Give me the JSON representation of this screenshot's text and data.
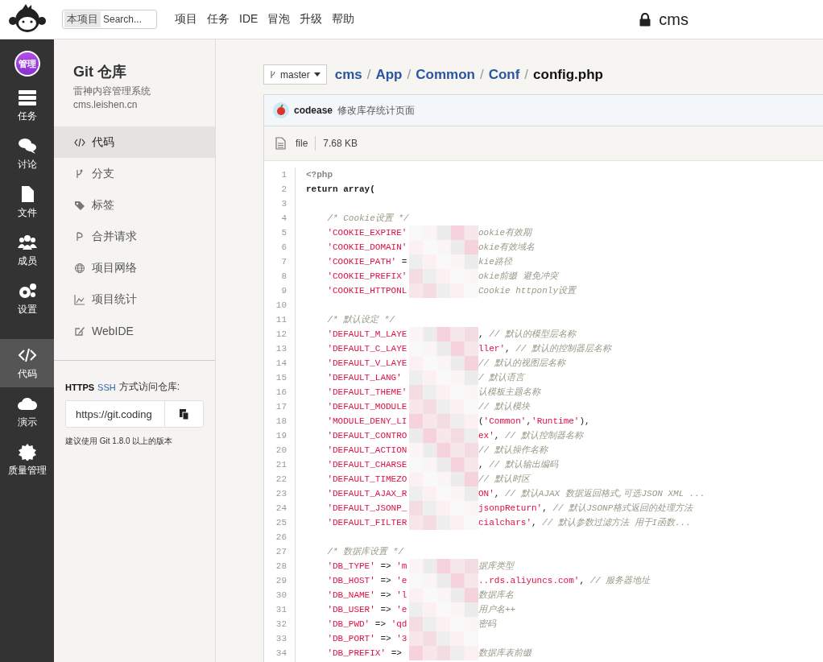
{
  "topbar": {
    "search_scope": "本项目",
    "search_placeholder": "Search...",
    "nav": [
      "项目",
      "任务",
      "IDE",
      "冒泡",
      "升级",
      "帮助"
    ],
    "project": "cms"
  },
  "rail": {
    "avatar": "管理",
    "items": [
      {
        "label": "任务",
        "kind": "tasks",
        "selected": false
      },
      {
        "label": "讨论",
        "kind": "chat",
        "selected": false
      },
      {
        "label": "文件",
        "kind": "file",
        "selected": false
      },
      {
        "label": "成员",
        "kind": "users",
        "selected": false
      },
      {
        "label": "设置",
        "kind": "gears",
        "selected": false
      }
    ],
    "bottom_items": [
      {
        "label": "代码",
        "kind": "code",
        "selected": true
      },
      {
        "label": "演示",
        "kind": "cloud",
        "selected": false
      },
      {
        "label": "质量管理",
        "kind": "badge",
        "selected": false
      }
    ]
  },
  "repo": {
    "title": "Git 仓库",
    "subtitle": "雷神内容管理系统",
    "domain": "cms.leishen.cn",
    "nav": [
      {
        "label": "代码",
        "kind": "code",
        "selected": true
      },
      {
        "label": "分支",
        "kind": "branch",
        "selected": false
      },
      {
        "label": "标签",
        "kind": "tag",
        "selected": false
      },
      {
        "label": "合并请求",
        "kind": "merge",
        "selected": false
      },
      {
        "label": "项目网络",
        "kind": "globe",
        "selected": false
      },
      {
        "label": "项目统计",
        "kind": "chart",
        "selected": false
      },
      {
        "label": "WebIDE",
        "kind": "edit",
        "selected": false
      }
    ],
    "clone": {
      "protocols": [
        {
          "label": "HTTPS",
          "selected": true
        },
        {
          "label": "SSH",
          "selected": false
        }
      ],
      "label": "方式访问仓库:",
      "url": "https://git.coding",
      "note": "建议使用 Git 1.8.0 以上的版本"
    }
  },
  "file_view": {
    "branch": "master",
    "path": [
      "cms",
      "App",
      "Common",
      "Conf"
    ],
    "separator": "/",
    "file": "config.php",
    "commit": {
      "author": "codease",
      "message": "修改库存统计页面"
    },
    "info": {
      "type": "file",
      "size": "7.68 KB"
    },
    "lines": [
      {
        "n": "1",
        "pre": [
          {
            "kind": "meta",
            "text": "<?php"
          }
        ]
      },
      {
        "n": "2",
        "pre": [
          {
            "kind": "keyword",
            "text": "return array("
          }
        ]
      },
      {
        "n": "3"
      },
      {
        "n": "4",
        "pre": [
          {
            "kind": "comment",
            "text": "    /* Cookie设置 */"
          }
        ]
      },
      {
        "n": "5",
        "redacted": true,
        "pre": [
          {
            "kind": "key",
            "text": "    'COOKIE_EXPIRE'"
          }
        ],
        "post": [
          {
            "kind": "comment",
            "text": "ookie有效期"
          }
        ]
      },
      {
        "n": "6",
        "redacted": true,
        "pre": [
          {
            "kind": "key",
            "text": "    'COOKIE_DOMAIN'"
          }
        ],
        "post": [
          {
            "kind": "comment",
            "text": "okie有效域名"
          }
        ]
      },
      {
        "n": "7",
        "redacted": true,
        "pre": [
          {
            "kind": "key",
            "text": "    'COOKIE_PATH'"
          },
          {
            "kind": "operator",
            "text": " ="
          }
        ],
        "post": [
          {
            "kind": "comment",
            "text": "kie路径"
          }
        ]
      },
      {
        "n": "8",
        "redacted": true,
        "pre": [
          {
            "kind": "key",
            "text": "    'COOKIE_PREFIX'"
          }
        ],
        "post": [
          {
            "kind": "comment",
            "text": "okie前缀 避免冲突"
          }
        ]
      },
      {
        "n": "9",
        "redacted": true,
        "pre": [
          {
            "kind": "key",
            "text": "    'COOKIE_HTTPONL"
          }
        ],
        "post": [
          {
            "kind": "comment",
            "text": "Cookie httponly设置"
          }
        ]
      },
      {
        "n": "10"
      },
      {
        "n": "11",
        "pre": [
          {
            "kind": "comment",
            "text": "    /* 默认设定 */"
          }
        ]
      },
      {
        "n": "12",
        "redacted": true,
        "pre": [
          {
            "kind": "key",
            "text": "    'DEFAULT_M_LAYE"
          }
        ],
        "post": [
          {
            "kind": "operator",
            "text": ", "
          },
          {
            "kind": "comment",
            "text": "// 默认的模型层名称"
          }
        ]
      },
      {
        "n": "13",
        "redacted": true,
        "pre": [
          {
            "kind": "key",
            "text": "    'DEFAULT_C_LAYE"
          }
        ],
        "post": [
          {
            "kind": "string",
            "text": "ller'"
          },
          {
            "kind": "operator",
            "text": ", "
          },
          {
            "kind": "comment",
            "text": "// 默认的控制器层名称"
          }
        ]
      },
      {
        "n": "14",
        "redacted": true,
        "pre": [
          {
            "kind": "key",
            "text": "    'DEFAULT_V_LAYE"
          }
        ],
        "post": [
          {
            "kind": "comment",
            "text": "// 默认的视图层名称"
          }
        ]
      },
      {
        "n": "15",
        "redacted": true,
        "pre": [
          {
            "kind": "key",
            "text": "    'DEFAULT_LANG'"
          }
        ],
        "post": [
          {
            "kind": "comment",
            "text": "/ 默认语言"
          }
        ]
      },
      {
        "n": "16",
        "redacted": true,
        "pre": [
          {
            "kind": "key",
            "text": "    'DEFAULT_THEME'"
          }
        ],
        "post": [
          {
            "kind": "comment",
            "text": "认模板主题名称"
          }
        ]
      },
      {
        "n": "17",
        "redacted": true,
        "pre": [
          {
            "kind": "key",
            "text": "    'DEFAULT_MODULE"
          }
        ],
        "post": [
          {
            "kind": "comment",
            "text": "// 默认模块"
          }
        ]
      },
      {
        "n": "18",
        "redacted": true,
        "pre": [
          {
            "kind": "key",
            "text": "    'MODULE_DENY_LI"
          }
        ],
        "post": [
          {
            "kind": "operator",
            "text": "("
          },
          {
            "kind": "string",
            "text": "'Common'"
          },
          {
            "kind": "operator",
            "text": ","
          },
          {
            "kind": "string",
            "text": "'Runtime'"
          },
          {
            "kind": "operator",
            "text": "),"
          }
        ]
      },
      {
        "n": "19",
        "redacted": true,
        "pre": [
          {
            "kind": "key",
            "text": "    'DEFAULT_CONTRO"
          }
        ],
        "post": [
          {
            "kind": "string",
            "text": "ex'"
          },
          {
            "kind": "operator",
            "text": ", "
          },
          {
            "kind": "comment",
            "text": "// 默认控制器名称"
          }
        ]
      },
      {
        "n": "20",
        "redacted": true,
        "pre": [
          {
            "kind": "key",
            "text": "    'DEFAULT_ACTION"
          }
        ],
        "post": [
          {
            "kind": "comment",
            "text": "// 默认操作名称"
          }
        ]
      },
      {
        "n": "21",
        "redacted": true,
        "pre": [
          {
            "kind": "key",
            "text": "    'DEFAULT_CHARSE"
          }
        ],
        "post": [
          {
            "kind": "operator",
            "text": ", "
          },
          {
            "kind": "comment",
            "text": "// 默认输出编码"
          }
        ]
      },
      {
        "n": "22",
        "redacted": true,
        "pre": [
          {
            "kind": "key",
            "text": "    'DEFAULT_TIMEZO"
          }
        ],
        "post": [
          {
            "kind": "comment",
            "text": "// 默认时区"
          }
        ]
      },
      {
        "n": "23",
        "redacted": true,
        "pre": [
          {
            "kind": "key",
            "text": "    'DEFAULT_AJAX_R"
          }
        ],
        "post": [
          {
            "kind": "string",
            "text": "ON'"
          },
          {
            "kind": "operator",
            "text": ", "
          },
          {
            "kind": "comment",
            "text": "// 默认AJAX 数据返回格式,可选JSON XML ..."
          }
        ]
      },
      {
        "n": "24",
        "redacted": true,
        "pre": [
          {
            "kind": "key",
            "text": "    'DEFAULT_JSONP_"
          }
        ],
        "post": [
          {
            "kind": "string",
            "text": "jsonpReturn'"
          },
          {
            "kind": "operator",
            "text": ", "
          },
          {
            "kind": "comment",
            "text": "// 默认JSONP格式返回的处理方法"
          }
        ]
      },
      {
        "n": "25",
        "redacted": true,
        "pre": [
          {
            "kind": "key",
            "text": "    'DEFAULT_FILTER"
          }
        ],
        "post": [
          {
            "kind": "string",
            "text": "cialchars'"
          },
          {
            "kind": "operator",
            "text": ", "
          },
          {
            "kind": "comment",
            "text": "// 默认参数过滤方法 用于I函数..."
          }
        ]
      },
      {
        "n": "26"
      },
      {
        "n": "27",
        "pre": [
          {
            "kind": "comment",
            "text": "    /* 数据库设置 */"
          }
        ]
      },
      {
        "n": "28",
        "redacted": true,
        "pre": [
          {
            "kind": "key",
            "text": "    'DB_TYPE'"
          },
          {
            "kind": "operator",
            "text": " => "
          },
          {
            "kind": "string",
            "text": "'m"
          }
        ],
        "post": [
          {
            "kind": "comment",
            "text": "据库类型"
          }
        ]
      },
      {
        "n": "29",
        "redacted": true,
        "pre": [
          {
            "kind": "key",
            "text": "    'DB_HOST'"
          },
          {
            "kind": "operator",
            "text": " => "
          },
          {
            "kind": "string",
            "text": "'e"
          }
        ],
        "post": [
          {
            "kind": "string",
            "text": "..rds.aliyuncs.com'"
          },
          {
            "kind": "operator",
            "text": ", "
          },
          {
            "kind": "comment",
            "text": "// 服务器地址"
          }
        ]
      },
      {
        "n": "30",
        "redacted": true,
        "pre": [
          {
            "kind": "key",
            "text": "    'DB_NAME'"
          },
          {
            "kind": "operator",
            "text": " => "
          },
          {
            "kind": "string",
            "text": "'l"
          }
        ],
        "post": [
          {
            "kind": "comment",
            "text": "数据库名"
          }
        ]
      },
      {
        "n": "31",
        "redacted": true,
        "pre": [
          {
            "kind": "key",
            "text": "    'DB_USER'"
          },
          {
            "kind": "operator",
            "text": " => "
          },
          {
            "kind": "string",
            "text": "'e"
          }
        ],
        "post": [
          {
            "kind": "comment",
            "text": "用户名++"
          }
        ]
      },
      {
        "n": "32",
        "redacted": true,
        "pre": [
          {
            "kind": "key",
            "text": "    'DB_PWD'"
          },
          {
            "kind": "operator",
            "text": " => "
          },
          {
            "kind": "string",
            "text": "'qd"
          }
        ],
        "post": [
          {
            "kind": "comment",
            "text": "密码"
          }
        ]
      },
      {
        "n": "33",
        "redacted": true,
        "pre": [
          {
            "kind": "key",
            "text": "    'DB_PORT'"
          },
          {
            "kind": "operator",
            "text": " => "
          },
          {
            "kind": "string",
            "text": "'3"
          }
        ]
      },
      {
        "n": "34",
        "redacted": true,
        "pre": [
          {
            "kind": "key",
            "text": "    'DB_PREFIX'"
          },
          {
            "kind": "operator",
            "text": " =>"
          }
        ],
        "post": [
          {
            "kind": "comment",
            "text": "数据库表前缀"
          }
        ]
      }
    ]
  }
}
